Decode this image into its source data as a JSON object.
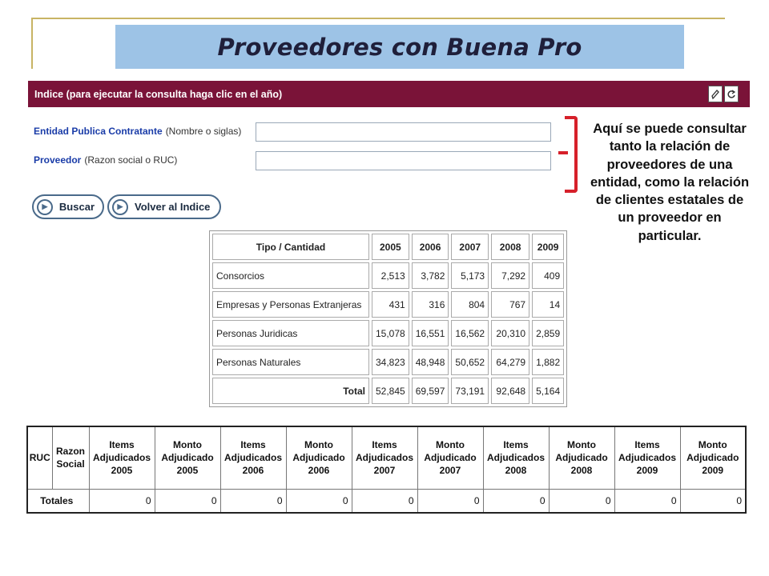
{
  "slide_title": "Proveedores con Buena Pro",
  "header": {
    "text": "Indice (para ejecutar la consulta haga clic en el año)",
    "icons": [
      "edit-icon",
      "refresh-icon"
    ]
  },
  "form": {
    "entidad_label": "Entidad Publica Contratante",
    "entidad_hint": "(Nombre o siglas)",
    "entidad_value": "",
    "proveedor_label": "Proveedor",
    "proveedor_hint": "(Razon social o RUC)",
    "proveedor_value": ""
  },
  "buttons": {
    "buscar": "Buscar",
    "volver": "Volver al Indice"
  },
  "note": "Aquí se puede consultar tanto la relación de proveedores de una entidad, como la relación de clientes estatales de un proveedor en particular.",
  "summary_table": {
    "headers": [
      "Tipo / Cantidad",
      "2005",
      "2006",
      "2007",
      "2008",
      "2009"
    ],
    "rows": [
      {
        "label": "Consorcios",
        "values": [
          "2,513",
          "3,782",
          "5,173",
          "7,292",
          "409"
        ]
      },
      {
        "label": "Empresas y Personas Extranjeras",
        "values": [
          "431",
          "316",
          "804",
          "767",
          "14"
        ]
      },
      {
        "label": "Personas Juridicas",
        "values": [
          "15,078",
          "16,551",
          "16,562",
          "20,310",
          "2,859"
        ]
      },
      {
        "label": "Personas Naturales",
        "values": [
          "34,823",
          "48,948",
          "50,652",
          "64,279",
          "1,882"
        ]
      }
    ],
    "total_label": "Total",
    "total_values": [
      "52,845",
      "69,597",
      "73,191",
      "92,648",
      "5,164"
    ]
  },
  "detail_table": {
    "headers": [
      "RUC",
      "Razon Social",
      "Items Adjudicados 2005",
      "Monto Adjudicado 2005",
      "Items Adjudicados 2006",
      "Monto Adjudicado 2006",
      "Items Adjudicados 2007",
      "Monto Adjudicado 2007",
      "Items Adjudicados 2008",
      "Monto Adjudicado 2008",
      "Items Adjudicados 2009",
      "Monto Adjudicado 2009"
    ],
    "totals_label": "Totales",
    "totals": [
      "0",
      "0",
      "0",
      "0",
      "0",
      "0",
      "0",
      "0",
      "0",
      "0"
    ]
  }
}
